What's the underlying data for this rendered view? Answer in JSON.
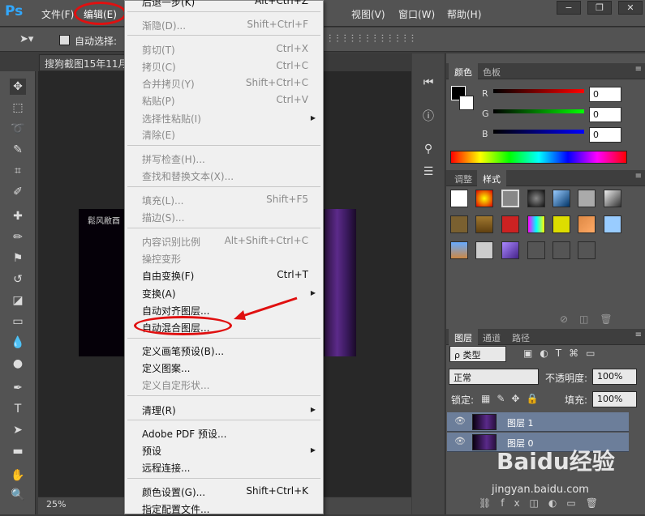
{
  "app": {
    "logo": "Ps"
  },
  "menubar": {
    "file": "文件(F)",
    "edit": "编辑(E)",
    "view": "视图(V)",
    "window": "窗口(W)",
    "help": "帮助(H)"
  },
  "options": {
    "auto_select": "自动选择:"
  },
  "document": {
    "tab_title": "搜狗截图15年11月",
    "zoom": "25%",
    "image_text": "鬆风敝酉"
  },
  "dropdown": {
    "items": [
      {
        "label": "后退一步(K)",
        "shortcut": "Alt+Ctrl+Z",
        "disabled": false
      },
      {
        "label": "渐隐(D)...",
        "shortcut": "Shift+Ctrl+F",
        "disabled": true
      },
      {
        "label": "剪切(T)",
        "shortcut": "Ctrl+X",
        "disabled": true
      },
      {
        "label": "拷贝(C)",
        "shortcut": "Ctrl+C",
        "disabled": true
      },
      {
        "label": "合并拷贝(Y)",
        "shortcut": "Shift+Ctrl+C",
        "disabled": true
      },
      {
        "label": "粘贴(P)",
        "shortcut": "Ctrl+V",
        "disabled": true
      },
      {
        "label": "选择性粘贴(I)",
        "shortcut": "",
        "disabled": true
      },
      {
        "label": "清除(E)",
        "shortcut": "",
        "disabled": true
      },
      {
        "label": "拼写检查(H)...",
        "shortcut": "",
        "disabled": true
      },
      {
        "label": "查找和替换文本(X)...",
        "shortcut": "",
        "disabled": true
      },
      {
        "label": "填充(L)...",
        "shortcut": "Shift+F5",
        "disabled": true
      },
      {
        "label": "描边(S)...",
        "shortcut": "",
        "disabled": true
      },
      {
        "label": "内容识别比例",
        "shortcut": "Alt+Shift+Ctrl+C",
        "disabled": true
      },
      {
        "label": "操控变形",
        "shortcut": "",
        "disabled": true
      },
      {
        "label": "自由变换(F)",
        "shortcut": "Ctrl+T",
        "disabled": false
      },
      {
        "label": "变换(A)",
        "shortcut": "",
        "disabled": false
      },
      {
        "label": "自动对齐图层...",
        "shortcut": "",
        "disabled": false
      },
      {
        "label": "自动混合图层...",
        "shortcut": "",
        "disabled": false
      },
      {
        "label": "定义画笔预设(B)...",
        "shortcut": "",
        "disabled": false
      },
      {
        "label": "定义图案...",
        "shortcut": "",
        "disabled": false
      },
      {
        "label": "定义自定形状...",
        "shortcut": "",
        "disabled": true
      },
      {
        "label": "清理(R)",
        "shortcut": "",
        "disabled": false
      },
      {
        "label": "Adobe PDF 预设...",
        "shortcut": "",
        "disabled": false
      },
      {
        "label": "预设",
        "shortcut": "",
        "disabled": false
      },
      {
        "label": "远程连接...",
        "shortcut": "",
        "disabled": false
      },
      {
        "label": "颜色设置(G)...",
        "shortcut": "Shift+Ctrl+K",
        "disabled": false
      },
      {
        "label": "指定配置文件...",
        "shortcut": "",
        "disabled": false
      }
    ]
  },
  "color_panel": {
    "tabs": [
      "颜色",
      "色板"
    ],
    "r_label": "R",
    "g_label": "G",
    "b_label": "B",
    "r": "0",
    "g": "0",
    "b": "0"
  },
  "styles_panel": {
    "tabs": [
      "调整",
      "样式"
    ]
  },
  "layers_panel": {
    "tabs": [
      "图层",
      "通道",
      "路径"
    ],
    "filter": "ρ 类型",
    "blend": "正常",
    "opacity_label": "不透明度:",
    "opacity": "100%",
    "lock_label": "锁定:",
    "fill_label": "填充:",
    "fill": "100%",
    "layers": [
      "图层 1",
      "图层 0"
    ]
  },
  "watermark": {
    "brand": "Baidu经验",
    "url": "jingyan.baidu.com"
  },
  "colors": {
    "highlight": "#e01010"
  }
}
